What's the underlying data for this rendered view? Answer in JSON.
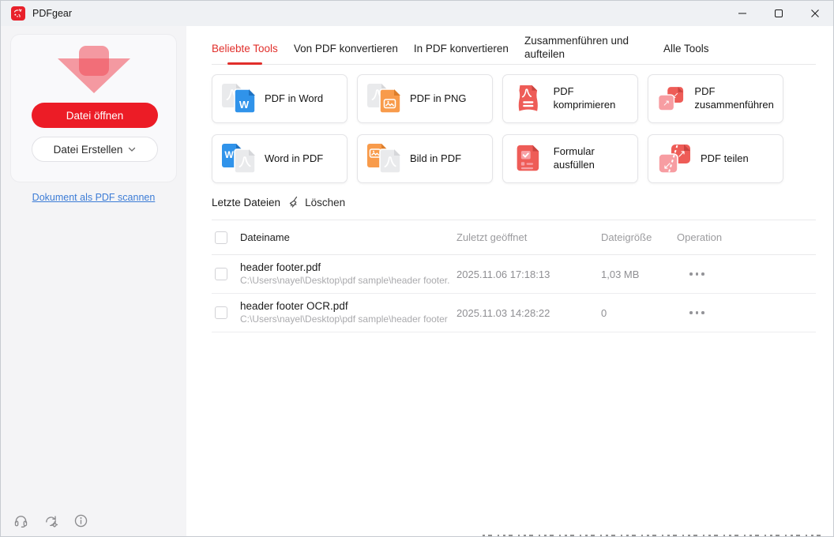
{
  "app": {
    "title": "PDFgear"
  },
  "colors": {
    "accent_red": "#ec1c26",
    "tab_active_red": "#e12f2b",
    "tool_red": "#ee5c57",
    "tool_pink": "#f79da2",
    "word_blue": "#3093ea",
    "image_orange": "#f89b4b",
    "link_blue": "#3c7cd6",
    "titlebar_bg": "#eff1f4",
    "sidebar_bg": "#f4f4f6"
  },
  "titlebar_icons": [
    "minimize-icon",
    "maximize-icon",
    "close-icon"
  ],
  "sidebar": {
    "open_button": "Datei öffnen",
    "create_button": "Datei Erstellen",
    "scan_link": "Dokument als PDF scannen",
    "footer_icons": [
      "support-headset-icon",
      "check-update-icon",
      "info-icon"
    ]
  },
  "tabs": [
    {
      "label": "Beliebte Tools",
      "active": true
    },
    {
      "label": "Von PDF konvertieren",
      "active": false
    },
    {
      "label": "In PDF konvertieren",
      "active": false
    },
    {
      "label": "Zusammenführen und aufteilen",
      "active": false
    },
    {
      "label": "Alle Tools",
      "active": false
    }
  ],
  "tools": [
    {
      "label": "PDF in Word",
      "icon": "pdf-to-word-icon"
    },
    {
      "label": "PDF in PNG",
      "icon": "pdf-to-png-icon"
    },
    {
      "label": "PDF komprimieren",
      "icon": "compress-pdf-icon"
    },
    {
      "label": "PDF zusammenführen",
      "icon": "merge-pdf-icon"
    },
    {
      "label": "Word in PDF",
      "icon": "word-to-pdf-icon"
    },
    {
      "label": "Bild in PDF",
      "icon": "image-to-pdf-icon"
    },
    {
      "label": "Formular ausfüllen",
      "icon": "fill-form-icon"
    },
    {
      "label": "PDF teilen",
      "icon": "split-pdf-icon"
    }
  ],
  "recent": {
    "title": "Letzte Dateien",
    "clear_label": "Löschen",
    "clear_icon": "broom-icon",
    "columns": [
      "Dateiname",
      "Zuletzt geöffnet",
      "Dateigröße",
      "Operation"
    ],
    "rows": [
      {
        "name": "header footer.pdf",
        "path": "C:\\Users\\nayel\\Desktop\\pdf sample\\header footer.",
        "opened": "2025.11.06 17:18:13",
        "size": "1,03 MB"
      },
      {
        "name": "header footer OCR.pdf",
        "path": "C:\\Users\\nayel\\Desktop\\pdf sample\\header footer",
        "opened": "2025.11.03 14:28:22",
        "size": "0"
      }
    ]
  }
}
